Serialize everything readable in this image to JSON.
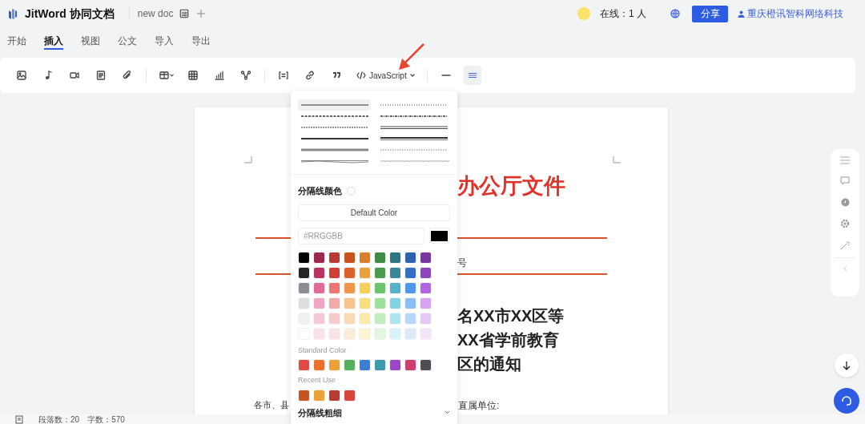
{
  "header": {
    "app_name": "JitWord 协同文档",
    "doc_name": "new doc",
    "online": "在线：1 人",
    "share_button": "分享",
    "user": "重庆橙讯智科网络科技"
  },
  "tabs": [
    {
      "label": "开始",
      "selected": false
    },
    {
      "label": "插入",
      "selected": true
    },
    {
      "label": "视图",
      "selected": false
    },
    {
      "label": "公文",
      "selected": false
    },
    {
      "label": "导入",
      "selected": false
    },
    {
      "label": "导出",
      "selected": false
    }
  ],
  "toolbar": [
    {
      "kind": "image",
      "selected": false
    },
    {
      "kind": "music",
      "selected": false
    },
    {
      "kind": "video",
      "selected": false
    },
    {
      "kind": "document",
      "selected": false
    },
    {
      "kind": "attachment",
      "selected": false
    },
    {
      "kind": "separator"
    },
    {
      "kind": "table-menu",
      "selected": false
    },
    {
      "kind": "grid",
      "selected": false
    },
    {
      "kind": "chart",
      "selected": false
    },
    {
      "kind": "nodes",
      "selected": false
    },
    {
      "kind": "separator"
    },
    {
      "kind": "formula",
      "selected": false
    },
    {
      "kind": "link",
      "selected": false
    },
    {
      "kind": "quote",
      "selected": false
    },
    {
      "kind": "code",
      "label": "JavaScript",
      "selected": false
    },
    {
      "kind": "separator"
    },
    {
      "kind": "line",
      "selected": false
    },
    {
      "kind": "divider",
      "selected": true
    }
  ],
  "document": {
    "title": "办公厅文件",
    "number": "号",
    "heading": [
      "名XX市XX区等",
      "XX省学前教育",
      "区的通知"
    ],
    "salutation_left": "各市、县",
    "salutation_right": "直属单位:"
  },
  "divider_popover": {
    "line_styles": [
      {
        "kind": "solid",
        "selected": true
      },
      {
        "kind": "dotted",
        "selected": false
      },
      {
        "kind": "dashed",
        "selected": false
      },
      {
        "kind": "dash-dot",
        "selected": false
      },
      {
        "kind": "fine-dashed",
        "selected": false
      },
      {
        "kind": "double",
        "selected": false
      },
      {
        "kind": "thick",
        "selected": false
      },
      {
        "kind": "thick-double",
        "selected": false
      },
      {
        "kind": "gradient",
        "selected": false
      },
      {
        "kind": "fine-dotted",
        "selected": false
      },
      {
        "kind": "wavy",
        "selected": false
      },
      {
        "kind": "zigzag",
        "selected": false
      }
    ],
    "color_label": "分隔线颜色",
    "default_color_button": "Default Color",
    "hex_input": {
      "placeholder": "#RRGGBB"
    },
    "palette": [
      [
        {
          "color": "#000000"
        },
        {
          "color": "#9b2a4e"
        },
        {
          "color": "#b83a32"
        },
        {
          "color": "#c9531f"
        },
        {
          "color": "#d97f2b"
        },
        {
          "color": "#3f8a46"
        },
        {
          "color": "#2f7583"
        },
        {
          "color": "#2e62ad"
        },
        {
          "color": "#7a36a0"
        }
      ],
      [
        {
          "color": "#222427"
        },
        {
          "color": "#b93461"
        },
        {
          "color": "#d13e38"
        },
        {
          "color": "#d9652a"
        },
        {
          "color": "#e9a23b"
        },
        {
          "color": "#4b9b4d"
        },
        {
          "color": "#3a8799"
        },
        {
          "color": "#3370c2"
        },
        {
          "color": "#8e44ba"
        }
      ],
      [
        {
          "color": "#8a8e93"
        },
        {
          "color": "#e06c95"
        },
        {
          "color": "#ec7570"
        },
        {
          "color": "#f0954a"
        },
        {
          "color": "#f6cf58"
        },
        {
          "color": "#6dc46f"
        },
        {
          "color": "#55b2cc"
        },
        {
          "color": "#4f97e8"
        },
        {
          "color": "#b265e2"
        }
      ],
      [
        {
          "color": "#dcdee1"
        },
        {
          "color": "#efa6c2"
        },
        {
          "color": "#f2a9a7"
        },
        {
          "color": "#f6c28e"
        },
        {
          "color": "#f8df7a"
        },
        {
          "color": "#9edf9b"
        },
        {
          "color": "#7fd3e3"
        },
        {
          "color": "#8cbef4"
        },
        {
          "color": "#d7a3f0"
        }
      ],
      [
        {
          "color": "#f0f1f3"
        },
        {
          "color": "#f5c8d8"
        },
        {
          "color": "#f7cbca"
        },
        {
          "color": "#f9dab6"
        },
        {
          "color": "#fbeaa8"
        },
        {
          "color": "#c3edc0"
        },
        {
          "color": "#aee6ef"
        },
        {
          "color": "#b8d7f8"
        },
        {
          "color": "#e7c9f6"
        }
      ],
      [
        {
          "color": "#ffffff"
        },
        {
          "color": "#f9e1ea"
        },
        {
          "color": "#fae3e2"
        },
        {
          "color": "#fcebd8"
        },
        {
          "color": "#fdf3cf"
        },
        {
          "color": "#e0f6de"
        },
        {
          "color": "#d5f3f8"
        },
        {
          "color": "#dbe9fb"
        },
        {
          "color": "#f3e4fb"
        }
      ]
    ],
    "standard_label": "Standard Color",
    "standard_colors": [
      {
        "color": "#e04a43"
      },
      {
        "color": "#e9712c"
      },
      {
        "color": "#eba337"
      },
      {
        "color": "#55ae5b"
      },
      {
        "color": "#3a7fd5"
      },
      {
        "color": "#3f98ac"
      },
      {
        "color": "#9c47c6"
      },
      {
        "color": "#cc3e6e"
      },
      {
        "color": "#4b4e53"
      }
    ],
    "recent_label": "Recent Use",
    "recent_colors": [
      {
        "color": "#c9531f"
      },
      {
        "color": "#eba337"
      },
      {
        "color": "#b83a32"
      },
      {
        "color": "#d7443c"
      }
    ],
    "thickness_label": "分隔线粗细"
  },
  "status_bar": {
    "paragraphs": "段落数：20",
    "words": "字数：570"
  }
}
